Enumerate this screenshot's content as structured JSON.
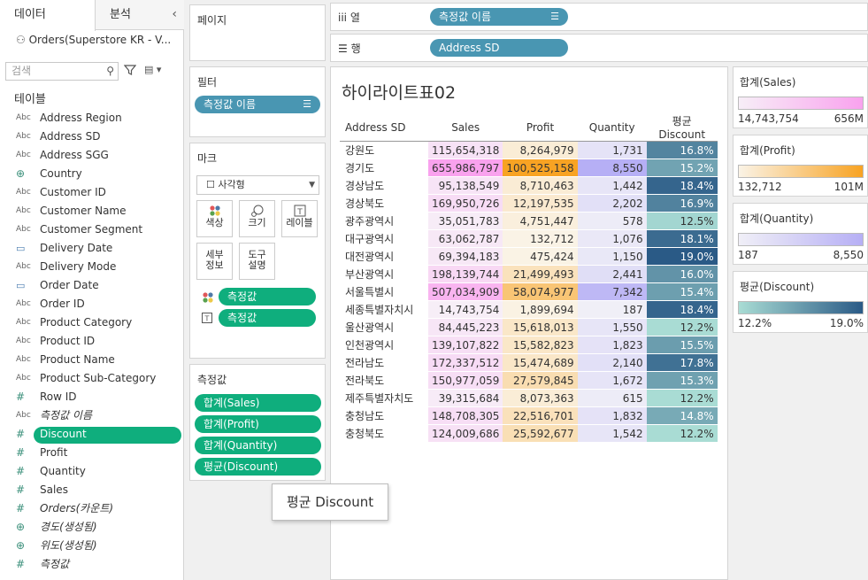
{
  "left_pane": {
    "tabs": [
      "데이터",
      "분석"
    ],
    "datasource": "Orders(Superstore KR - V...",
    "search_placeholder": "검색",
    "section_title": "테이블",
    "fields": [
      {
        "type": "Abc",
        "name": "Address Region",
        "italic": false,
        "selected": false
      },
      {
        "type": "Abc",
        "name": "Address SD",
        "italic": false,
        "selected": false
      },
      {
        "type": "Abc",
        "name": "Address SGG",
        "italic": false,
        "selected": false
      },
      {
        "type": "globe",
        "name": "Country",
        "italic": false,
        "selected": false
      },
      {
        "type": "Abc",
        "name": "Customer ID",
        "italic": false,
        "selected": false
      },
      {
        "type": "Abc",
        "name": "Customer Name",
        "italic": false,
        "selected": false
      },
      {
        "type": "Abc",
        "name": "Customer Segment",
        "italic": false,
        "selected": false
      },
      {
        "type": "date",
        "name": "Delivery Date",
        "italic": false,
        "selected": false
      },
      {
        "type": "Abc",
        "name": "Delivery Mode",
        "italic": false,
        "selected": false
      },
      {
        "type": "date",
        "name": "Order Date",
        "italic": false,
        "selected": false
      },
      {
        "type": "Abc",
        "name": "Order ID",
        "italic": false,
        "selected": false
      },
      {
        "type": "Abc",
        "name": "Product Category",
        "italic": false,
        "selected": false
      },
      {
        "type": "Abc",
        "name": "Product ID",
        "italic": false,
        "selected": false
      },
      {
        "type": "Abc",
        "name": "Product Name",
        "italic": false,
        "selected": false
      },
      {
        "type": "Abc",
        "name": "Product Sub-Category",
        "italic": false,
        "selected": false
      },
      {
        "type": "#",
        "name": "Row ID",
        "italic": false,
        "selected": false
      },
      {
        "type": "Abc",
        "name": "측정값 이름",
        "italic": true,
        "selected": false
      },
      {
        "type": "#",
        "name": "Discount",
        "italic": false,
        "selected": true
      },
      {
        "type": "#",
        "name": "Profit",
        "italic": false,
        "selected": false
      },
      {
        "type": "#",
        "name": "Quantity",
        "italic": false,
        "selected": false
      },
      {
        "type": "#",
        "name": "Sales",
        "italic": false,
        "selected": false
      },
      {
        "type": "#",
        "name": "Orders(카운트)",
        "italic": true,
        "selected": false
      },
      {
        "type": "globe",
        "name": "경도(생성됨)",
        "italic": true,
        "selected": false
      },
      {
        "type": "globe",
        "name": "위도(생성됨)",
        "italic": true,
        "selected": false
      },
      {
        "type": "#",
        "name": "측정값",
        "italic": true,
        "selected": false
      }
    ]
  },
  "cards": {
    "pages_title": "페이지",
    "filters_title": "필터",
    "filter_pill": "측정값 이름",
    "marks_title": "마크",
    "mark_type": "사각형",
    "mark_buttons": [
      "색상",
      "크기",
      "레이블",
      "세부\n정보",
      "도구\n설명"
    ],
    "mark_pills": [
      "측정값",
      "측정값"
    ],
    "measures_title": "측정값",
    "measure_pills": [
      "합계(Sales)",
      "합계(Profit)",
      "합계(Quantity)",
      "평균(Discount)"
    ]
  },
  "shelves": {
    "columns_label": "열",
    "columns_pill": "측정값 이름",
    "rows_label": "행",
    "rows_pill": "Address SD"
  },
  "viz": {
    "title": "하이라이트표02",
    "headers": [
      "Address SD",
      "Sales",
      "Profit",
      "Quantity",
      "평균 Discount"
    ],
    "rows": [
      {
        "sd": "강원도",
        "sales": "115,654,318",
        "profit": "8,264,979",
        "qty": "1,731",
        "disc": "16.8%",
        "sales_v": 115654318,
        "profit_v": 8264979,
        "qty_v": 1731,
        "disc_v": 16.8
      },
      {
        "sd": "경기도",
        "sales": "655,986,797",
        "profit": "100,525,158",
        "qty": "8,550",
        "disc": "15.2%",
        "sales_v": 655986797,
        "profit_v": 100525158,
        "qty_v": 8550,
        "disc_v": 15.2
      },
      {
        "sd": "경상남도",
        "sales": "95,138,549",
        "profit": "8,710,463",
        "qty": "1,442",
        "disc": "18.4%",
        "sales_v": 95138549,
        "profit_v": 8710463,
        "qty_v": 1442,
        "disc_v": 18.4
      },
      {
        "sd": "경상북도",
        "sales": "169,950,726",
        "profit": "12,197,535",
        "qty": "2,202",
        "disc": "16.9%",
        "sales_v": 169950726,
        "profit_v": 12197535,
        "qty_v": 2202,
        "disc_v": 16.9
      },
      {
        "sd": "광주광역시",
        "sales": "35,051,783",
        "profit": "4,751,447",
        "qty": "578",
        "disc": "12.5%",
        "sales_v": 35051783,
        "profit_v": 4751447,
        "qty_v": 578,
        "disc_v": 12.5
      },
      {
        "sd": "대구광역시",
        "sales": "63,062,787",
        "profit": "132,712",
        "qty": "1,076",
        "disc": "18.1%",
        "sales_v": 63062787,
        "profit_v": 132712,
        "qty_v": 1076,
        "disc_v": 18.1
      },
      {
        "sd": "대전광역시",
        "sales": "69,394,183",
        "profit": "475,424",
        "qty": "1,150",
        "disc": "19.0%",
        "sales_v": 69394183,
        "profit_v": 475424,
        "qty_v": 1150,
        "disc_v": 19.0
      },
      {
        "sd": "부산광역시",
        "sales": "198,139,744",
        "profit": "21,499,493",
        "qty": "2,441",
        "disc": "16.0%",
        "sales_v": 198139744,
        "profit_v": 21499493,
        "qty_v": 2441,
        "disc_v": 16.0
      },
      {
        "sd": "서울특별시",
        "sales": "507,034,909",
        "profit": "58,074,977",
        "qty": "7,342",
        "disc": "15.4%",
        "sales_v": 507034909,
        "profit_v": 58074977,
        "qty_v": 7342,
        "disc_v": 15.4
      },
      {
        "sd": "세종특별자치시",
        "sales": "14,743,754",
        "profit": "1,899,694",
        "qty": "187",
        "disc": "18.4%",
        "sales_v": 14743754,
        "profit_v": 1899694,
        "qty_v": 187,
        "disc_v": 18.4
      },
      {
        "sd": "울산광역시",
        "sales": "84,445,223",
        "profit": "15,618,013",
        "qty": "1,550",
        "disc": "12.2%",
        "sales_v": 84445223,
        "profit_v": 15618013,
        "qty_v": 1550,
        "disc_v": 12.2
      },
      {
        "sd": "인천광역시",
        "sales": "139,107,822",
        "profit": "15,582,823",
        "qty": "1,823",
        "disc": "15.5%",
        "sales_v": 139107822,
        "profit_v": 15582823,
        "qty_v": 1823,
        "disc_v": 15.5
      },
      {
        "sd": "전라남도",
        "sales": "172,337,512",
        "profit": "15,474,689",
        "qty": "2,140",
        "disc": "17.8%",
        "sales_v": 172337512,
        "profit_v": 15474689,
        "qty_v": 2140,
        "disc_v": 17.8
      },
      {
        "sd": "전라북도",
        "sales": "150,977,059",
        "profit": "27,579,845",
        "qty": "1,672",
        "disc": "15.3%",
        "sales_v": 150977059,
        "profit_v": 27579845,
        "qty_v": 1672,
        "disc_v": 15.3
      },
      {
        "sd": "제주특별자치도",
        "sales": "39,315,684",
        "profit": "8,073,363",
        "qty": "615",
        "disc": "12.2%",
        "sales_v": 39315684,
        "profit_v": 8073363,
        "qty_v": 615,
        "disc_v": 12.2
      },
      {
        "sd": "충청남도",
        "sales": "148,708,305",
        "profit": "22,516,701",
        "qty": "1,832",
        "disc": "14.8%",
        "sales_v": 148708305,
        "profit_v": 22516701,
        "qty_v": 1832,
        "disc_v": 14.8
      },
      {
        "sd": "충청북도",
        "sales": "124,009,686",
        "profit": "25,592,677",
        "qty": "1,542",
        "disc": "12.2%",
        "sales_v": 124009686,
        "profit_v": 25592677,
        "qty_v": 1542,
        "disc_v": 12.2
      }
    ]
  },
  "legends": [
    {
      "title": "합계(Sales)",
      "min": "14,743,754",
      "max": "656M",
      "from": "#f7eef7",
      "to": "#f9a2ee"
    },
    {
      "title": "합계(Profit)",
      "min": "132,712",
      "max": "101M",
      "from": "#faf3e6",
      "to": "#f8a323"
    },
    {
      "title": "합계(Quantity)",
      "min": "187",
      "max": "8,550",
      "from": "#f0eff7",
      "to": "#b6aff5"
    },
    {
      "title": "평균(Discount)",
      "min": "12.2%",
      "max": "19.0%",
      "from": "#a9dcd4",
      "to": "#2a5a86"
    }
  ],
  "tooltip": "평균 Discount",
  "colors": {
    "accent_green": "#0fae7d",
    "pill_blue": "#4996b2"
  }
}
